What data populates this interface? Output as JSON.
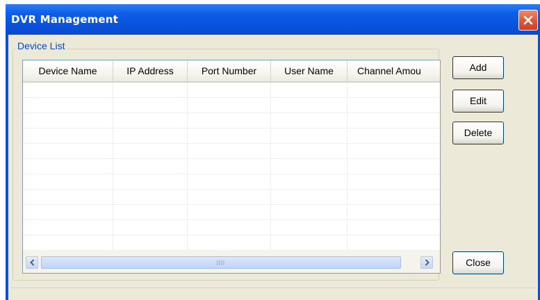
{
  "window": {
    "title": "DVR Management"
  },
  "device_list": {
    "label": "Device List",
    "columns": [
      "Device Name",
      "IP Address",
      "Port Number",
      "User Name",
      "Channel Amou"
    ],
    "rows": []
  },
  "buttons": {
    "add": "Add",
    "edit": "Edit",
    "delete": "Delete",
    "close": "Close"
  },
  "colors": {
    "titlebar": "#0A52DC",
    "dialog_bg": "#ECE9D8",
    "close_button": "#E05A3A",
    "group_label": "#0046D5"
  },
  "icons": {
    "close": "close-icon",
    "scroll_left": "arrow-left-icon",
    "scroll_right": "arrow-right-icon"
  }
}
